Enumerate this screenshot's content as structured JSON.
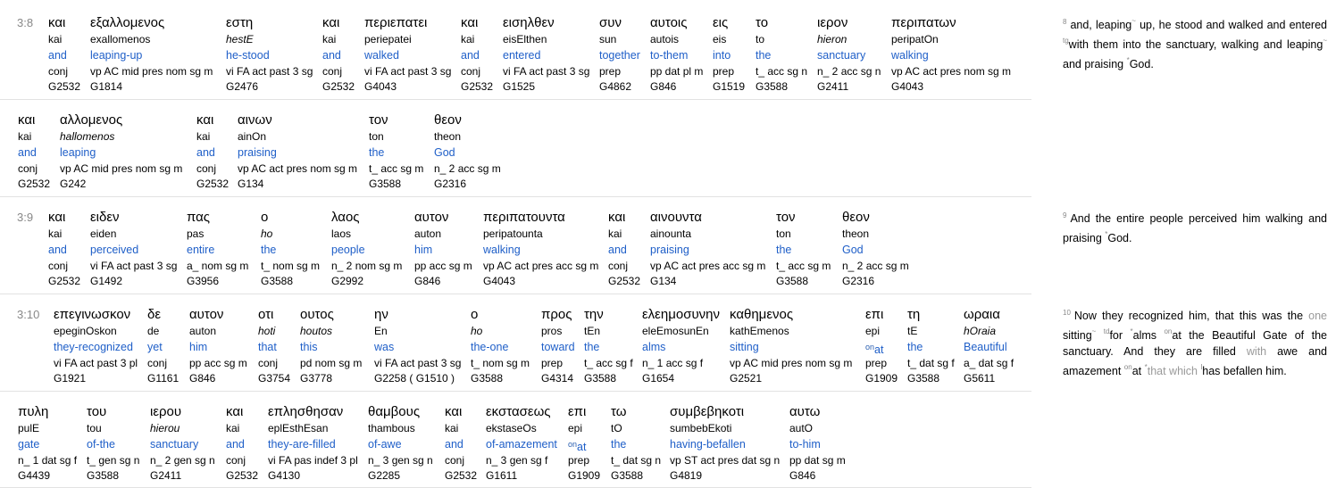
{
  "interlinear": {
    "lines": [
      {
        "verse_ref": {
          "chapter": "3:",
          "verse": "8"
        },
        "words": [
          {
            "greek": "και",
            "translit": "kai",
            "english": "and",
            "parse": "conj",
            "strong": "G2532"
          },
          {
            "greek": "εξαλλομενος",
            "translit": "exallomenos",
            "english": "leaping-up",
            "parse": "vp AC mid pres nom sg m",
            "strong": "G1814"
          },
          {
            "greek": "εστη",
            "translit": "hestE",
            "english": "he-stood",
            "parse": "vi FA act past 3 sg",
            "strong": "G2476",
            "translit_italic": true
          },
          {
            "greek": "και",
            "translit": "kai",
            "english": "and",
            "parse": "conj",
            "strong": "G2532"
          },
          {
            "greek": "περιεπατει",
            "translit": "periepatei",
            "english": "walked",
            "parse": "vi FA act past 3 sg",
            "strong": "G4043"
          },
          {
            "greek": "και",
            "translit": "kai",
            "english": "and",
            "parse": "conj",
            "strong": "G2532"
          },
          {
            "greek": "εισηλθεν",
            "translit": "eisElthen",
            "english": "entered",
            "parse": "vi FA act past 3 sg",
            "strong": "G1525"
          },
          {
            "greek": "συν",
            "translit": "sun",
            "english": "together",
            "parse": "prep",
            "strong": "G4862"
          },
          {
            "greek": "αυτοις",
            "translit": "autois",
            "english": "to-them",
            "parse": "pp dat pl m",
            "strong": "G846"
          },
          {
            "greek": "εις",
            "translit": "eis",
            "english": "into",
            "parse": "prep",
            "strong": "G1519"
          },
          {
            "greek": "το",
            "translit": "to",
            "english": "the",
            "parse": "t_ acc sg n",
            "strong": "G3588"
          },
          {
            "greek": "ιερον",
            "translit": "hieron",
            "english": "sanctuary",
            "parse": "n_ 2 acc sg n",
            "strong": "G2411",
            "translit_italic": true
          },
          {
            "greek": "περιπατων",
            "translit": "peripatOn",
            "english": "walking",
            "parse": "vp AC act pres nom sg m",
            "strong": "G4043"
          }
        ]
      },
      {
        "verse_ref": null,
        "words": [
          {
            "greek": "και",
            "translit": "kai",
            "english": "and",
            "parse": "conj",
            "strong": "G2532"
          },
          {
            "greek": "αλλομενος",
            "translit": "hallomenos",
            "english": "leaping",
            "parse": "vp AC mid pres nom sg m",
            "strong": "G242",
            "translit_italic": true
          },
          {
            "greek": "και",
            "translit": "kai",
            "english": "and",
            "parse": "conj",
            "strong": "G2532"
          },
          {
            "greek": "αινων",
            "translit": "ainOn",
            "english": "praising",
            "parse": "vp AC act pres nom sg m",
            "strong": "G134"
          },
          {
            "greek": "τον",
            "translit": "ton",
            "english": "the",
            "parse": "t_ acc sg m",
            "strong": "G3588"
          },
          {
            "greek": "θεον",
            "translit": "theon",
            "english": "God",
            "parse": "n_ 2 acc sg m",
            "strong": "G2316"
          }
        ]
      },
      {
        "verse_ref": {
          "chapter": "3:",
          "verse": "9"
        },
        "words": [
          {
            "greek": "και",
            "translit": "kai",
            "english": "and",
            "parse": "conj",
            "strong": "G2532"
          },
          {
            "greek": "ειδεν",
            "translit": "eiden",
            "english": "perceived",
            "parse": "vi FA act past 3 sg",
            "strong": "G1492"
          },
          {
            "greek": "πας",
            "translit": "pas",
            "english": "entire",
            "parse": "a_ nom sg m",
            "strong": "G3956"
          },
          {
            "greek": "ο",
            "translit": "ho",
            "english": "the",
            "parse": "t_ nom sg m",
            "strong": "G3588",
            "translit_italic": true
          },
          {
            "greek": "λαος",
            "translit": "laos",
            "english": "people",
            "parse": "n_ 2 nom sg m",
            "strong": "G2992"
          },
          {
            "greek": "αυτον",
            "translit": "auton",
            "english": "him",
            "parse": "pp acc sg m",
            "strong": "G846"
          },
          {
            "greek": "περιπατουντα",
            "translit": "peripatounta",
            "english": "walking",
            "parse": "vp AC act pres acc sg m",
            "strong": "G4043"
          },
          {
            "greek": "και",
            "translit": "kai",
            "english": "and",
            "parse": "conj",
            "strong": "G2532"
          },
          {
            "greek": "αινουντα",
            "translit": "ainounta",
            "english": "praising",
            "parse": "vp AC act pres acc sg m",
            "strong": "G134"
          },
          {
            "greek": "τον",
            "translit": "ton",
            "english": "the",
            "parse": "t_ acc sg m",
            "strong": "G3588"
          },
          {
            "greek": "θεον",
            "translit": "theon",
            "english": "God",
            "parse": "n_ 2 acc sg m",
            "strong": "G2316"
          }
        ]
      },
      {
        "verse_ref": {
          "chapter": "3:",
          "verse": "10"
        },
        "words": [
          {
            "greek": "επεγινωσκον",
            "translit": "epeginOskon",
            "english": "they-recognized",
            "parse": "vi FA act past 3 pl",
            "strong": "G1921"
          },
          {
            "greek": "δε",
            "translit": "de",
            "english": "yet",
            "parse": "conj",
            "strong": "G1161"
          },
          {
            "greek": "αυτον",
            "translit": "auton",
            "english": "him",
            "parse": "pp acc sg m",
            "strong": "G846"
          },
          {
            "greek": "οτι",
            "translit": "hoti",
            "english": "that",
            "parse": "conj",
            "strong": "G3754",
            "translit_italic": true
          },
          {
            "greek": "ουτος",
            "translit": "houtos",
            "english": "this",
            "parse": "pd nom sg m",
            "strong": "G3778",
            "translit_italic": true
          },
          {
            "greek": "ην",
            "translit": "En",
            "english": "was",
            "parse": "vi FA act past 3 sg",
            "strong": "G2258 ( G1510 )"
          },
          {
            "greek": "ο",
            "translit": "ho",
            "english": "the-one",
            "parse": "t_ nom sg m",
            "strong": "G3588",
            "translit_italic": true
          },
          {
            "greek": "προς",
            "translit": "pros",
            "english": "toward",
            "parse": "prep",
            "strong": "G4314"
          },
          {
            "greek": "την",
            "translit": "tEn",
            "english": "the",
            "parse": "t_ acc sg f",
            "strong": "G3588"
          },
          {
            "greek": "ελεημοσυνην",
            "translit": "eleEmosunEn",
            "english": "alms",
            "parse": "n_ 1 acc sg f",
            "strong": "G1654"
          },
          {
            "greek": "καθημενος",
            "translit": "kathEmenos",
            "english": "sitting",
            "parse": "vp AC mid pres nom sg m",
            "strong": "G2521"
          },
          {
            "greek": "επι",
            "translit": "epi",
            "english": "at",
            "english_sup": "on",
            "parse": "prep",
            "strong": "G1909"
          },
          {
            "greek": "τη",
            "translit": "tE",
            "english": "the",
            "parse": "t_ dat sg f",
            "strong": "G3588"
          },
          {
            "greek": "ωραια",
            "translit": "hOraia",
            "english": "Beautiful",
            "parse": "a_ dat sg f",
            "strong": "G5611",
            "translit_italic": true
          }
        ]
      },
      {
        "verse_ref": null,
        "words": [
          {
            "greek": "πυλη",
            "translit": "pulE",
            "english": "gate",
            "parse": "n_ 1 dat sg f",
            "strong": "G4439"
          },
          {
            "greek": "του",
            "translit": "tou",
            "english": "of-the",
            "parse": "t_ gen sg n",
            "strong": "G3588"
          },
          {
            "greek": "ιερου",
            "translit": "hierou",
            "english": "sanctuary",
            "parse": "n_ 2 gen sg n",
            "strong": "G2411",
            "translit_italic": true
          },
          {
            "greek": "και",
            "translit": "kai",
            "english": "and",
            "parse": "conj",
            "strong": "G2532"
          },
          {
            "greek": "επλησθησαν",
            "translit": "eplEsthEsan",
            "english": "they-are-filled",
            "parse": "vi FA pas indef 3 pl",
            "strong": "G4130"
          },
          {
            "greek": "θαμβους",
            "translit": "thambous",
            "english": "of-awe",
            "parse": "n_ 3 gen sg n",
            "strong": "G2285"
          },
          {
            "greek": "και",
            "translit": "kai",
            "english": "and",
            "parse": "conj",
            "strong": "G2532"
          },
          {
            "greek": "εκστασεως",
            "translit": "ekstaseOs",
            "english": "of-amazement",
            "parse": "n_ 3 gen sg f",
            "strong": "G1611"
          },
          {
            "greek": "επι",
            "translit": "epi",
            "english": "at",
            "english_sup": "on",
            "parse": "prep",
            "strong": "G1909"
          },
          {
            "greek": "τω",
            "translit": "tO",
            "english": "the",
            "parse": "t_ dat sg n",
            "strong": "G3588"
          },
          {
            "greek": "συμβεβηκοτι",
            "translit": "sumbebEkoti",
            "english": "having-befallen",
            "parse": "vp ST act pres dat sg n",
            "strong": "G4819"
          },
          {
            "greek": "αυτω",
            "translit": "autO",
            "english": "to-him",
            "parse": "pp dat sg m",
            "strong": "G846"
          }
        ]
      }
    ]
  },
  "translation": {
    "verses": [
      {
        "number": "8",
        "segments": [
          {
            "text": "and, leaping"
          },
          {
            "mark": "~"
          },
          {
            "text": " up, he stood and walked and entered "
          },
          {
            "mark": "tg"
          },
          {
            "text": "with them into the sanctuary, walking and leaping"
          },
          {
            "mark": "~"
          },
          {
            "text": " and praising "
          },
          {
            "mark": "*"
          },
          {
            "text": "God."
          }
        ]
      },
      {
        "number": "9",
        "segments": [
          {
            "text": "And the entire people perceived him walking and praising "
          },
          {
            "mark": "*"
          },
          {
            "text": "God."
          }
        ]
      },
      {
        "number": "10",
        "segments": [
          {
            "text": "Now they recognized him, that this was the "
          },
          {
            "gray": "one"
          },
          {
            "text": " sitting"
          },
          {
            "mark": "~"
          },
          {
            "text": " "
          },
          {
            "mark": "td"
          },
          {
            "text": "for "
          },
          {
            "mark": "*"
          },
          {
            "text": "alms "
          },
          {
            "mark": "on"
          },
          {
            "text": "at the Beautiful Gate of the sanctuary. And they are filled "
          },
          {
            "gray": "with"
          },
          {
            "text": " awe and amazement "
          },
          {
            "mark": "on"
          },
          {
            "text": "at "
          },
          {
            "mark": "*"
          },
          {
            "gray": "that which"
          },
          {
            "text": " "
          },
          {
            "mark": "l"
          },
          {
            "text": "has befallen him."
          }
        ]
      }
    ]
  }
}
